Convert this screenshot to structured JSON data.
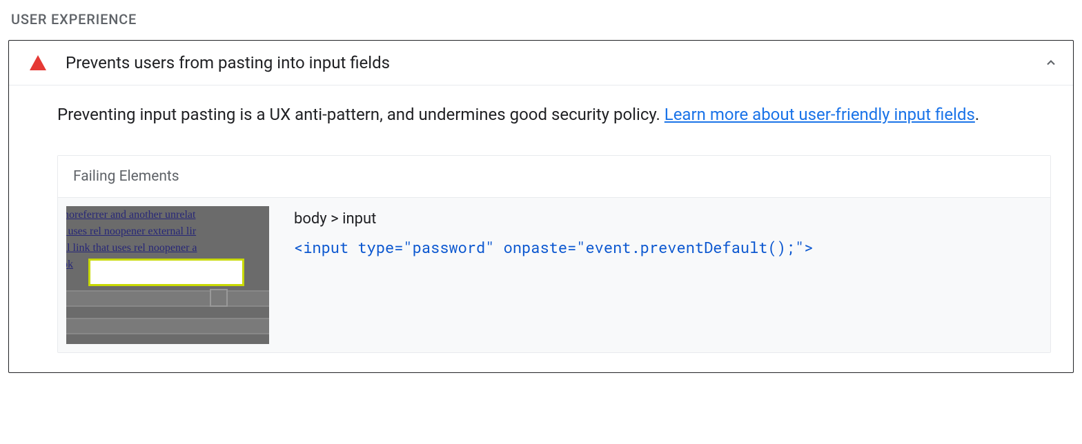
{
  "section": {
    "title": "USER EXPERIENCE"
  },
  "audit": {
    "title": "Prevents users from pasting into input fields",
    "descriptionPrefix": "Preventing input pasting is a UX anti-pattern, and undermines good security policy. ",
    "learnMoreText": "Learn more about user-friendly input fields",
    "period": "."
  },
  "details": {
    "header": "Failing Elements",
    "thumbnail": {
      "line1": "noreferrer and another unrelat",
      "line2": "t uses rel noopener external lir",
      "line3": "al link that uses rel noopener a",
      "line4": "ok"
    },
    "element": {
      "selector": "body > input",
      "snippet": "<input type=\"password\" onpaste=\"event.preventDefault();\">"
    }
  }
}
